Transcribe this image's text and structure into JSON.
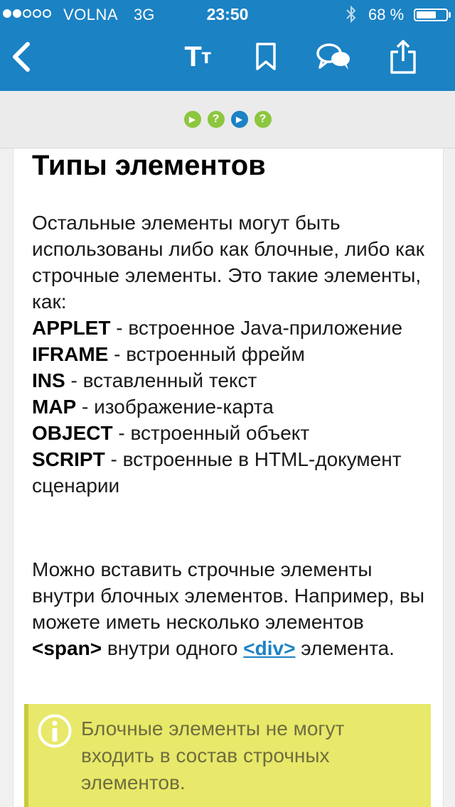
{
  "status_bar": {
    "carrier": "VOLNA",
    "network": "3G",
    "time": "23:50",
    "battery_percent": "68 %",
    "battery_level": 0.68,
    "signal_bars_filled": 2,
    "signal_bars_total": 5
  },
  "toolbar": {
    "back_icon": "chevron-left-icon",
    "font_size_label_big": "T",
    "font_size_label_small": "т",
    "bookmark_icon": "bookmark-icon",
    "comments_icon": "speech-bubbles-icon",
    "share_icon": "share-icon"
  },
  "lesson_steps": [
    {
      "type": "play",
      "glyph": "▶",
      "status": "done"
    },
    {
      "type": "quiz",
      "glyph": "?",
      "status": "done"
    },
    {
      "type": "play",
      "glyph": "▶",
      "status": "current"
    },
    {
      "type": "quiz",
      "glyph": "?",
      "status": "done"
    }
  ],
  "article": {
    "title": "Типы элементов",
    "intro": "Остальные элементы могут быть использованы либо как блочные, либо как строчные элементы. Это такие элементы, как:",
    "elements": [
      {
        "name": "APPLET",
        "desc": " - встроенное Java-приложение"
      },
      {
        "name": "IFRAME",
        "desc": " - встроенный фрейм"
      },
      {
        "name": "INS",
        "desc": " - вставленный текст"
      },
      {
        "name": "MAP",
        "desc": " - изображение-карта"
      },
      {
        "name": "OBJECT",
        "desc": " - встроенный объект"
      },
      {
        "name": "SCRIPT",
        "desc": " - встроенные в HTML-документ сценарии"
      }
    ],
    "p2_before": "Можно вставить строчные элементы внутри блочных элементов. Например, вы можете иметь несколько элементов ",
    "p2_tag": "<span>",
    "p2_middle": " внутри одного ",
    "p2_link": "<div>",
    "p2_after": " элемента."
  },
  "note": {
    "icon": "info-icon",
    "text": "Блочные элементы не могут входить в состав строчных элементов."
  },
  "colors": {
    "header_blue": "#1b82c4",
    "step_green": "#8dc63f",
    "note_yellow": "#e8e86a",
    "note_text": "#6e6e40"
  }
}
